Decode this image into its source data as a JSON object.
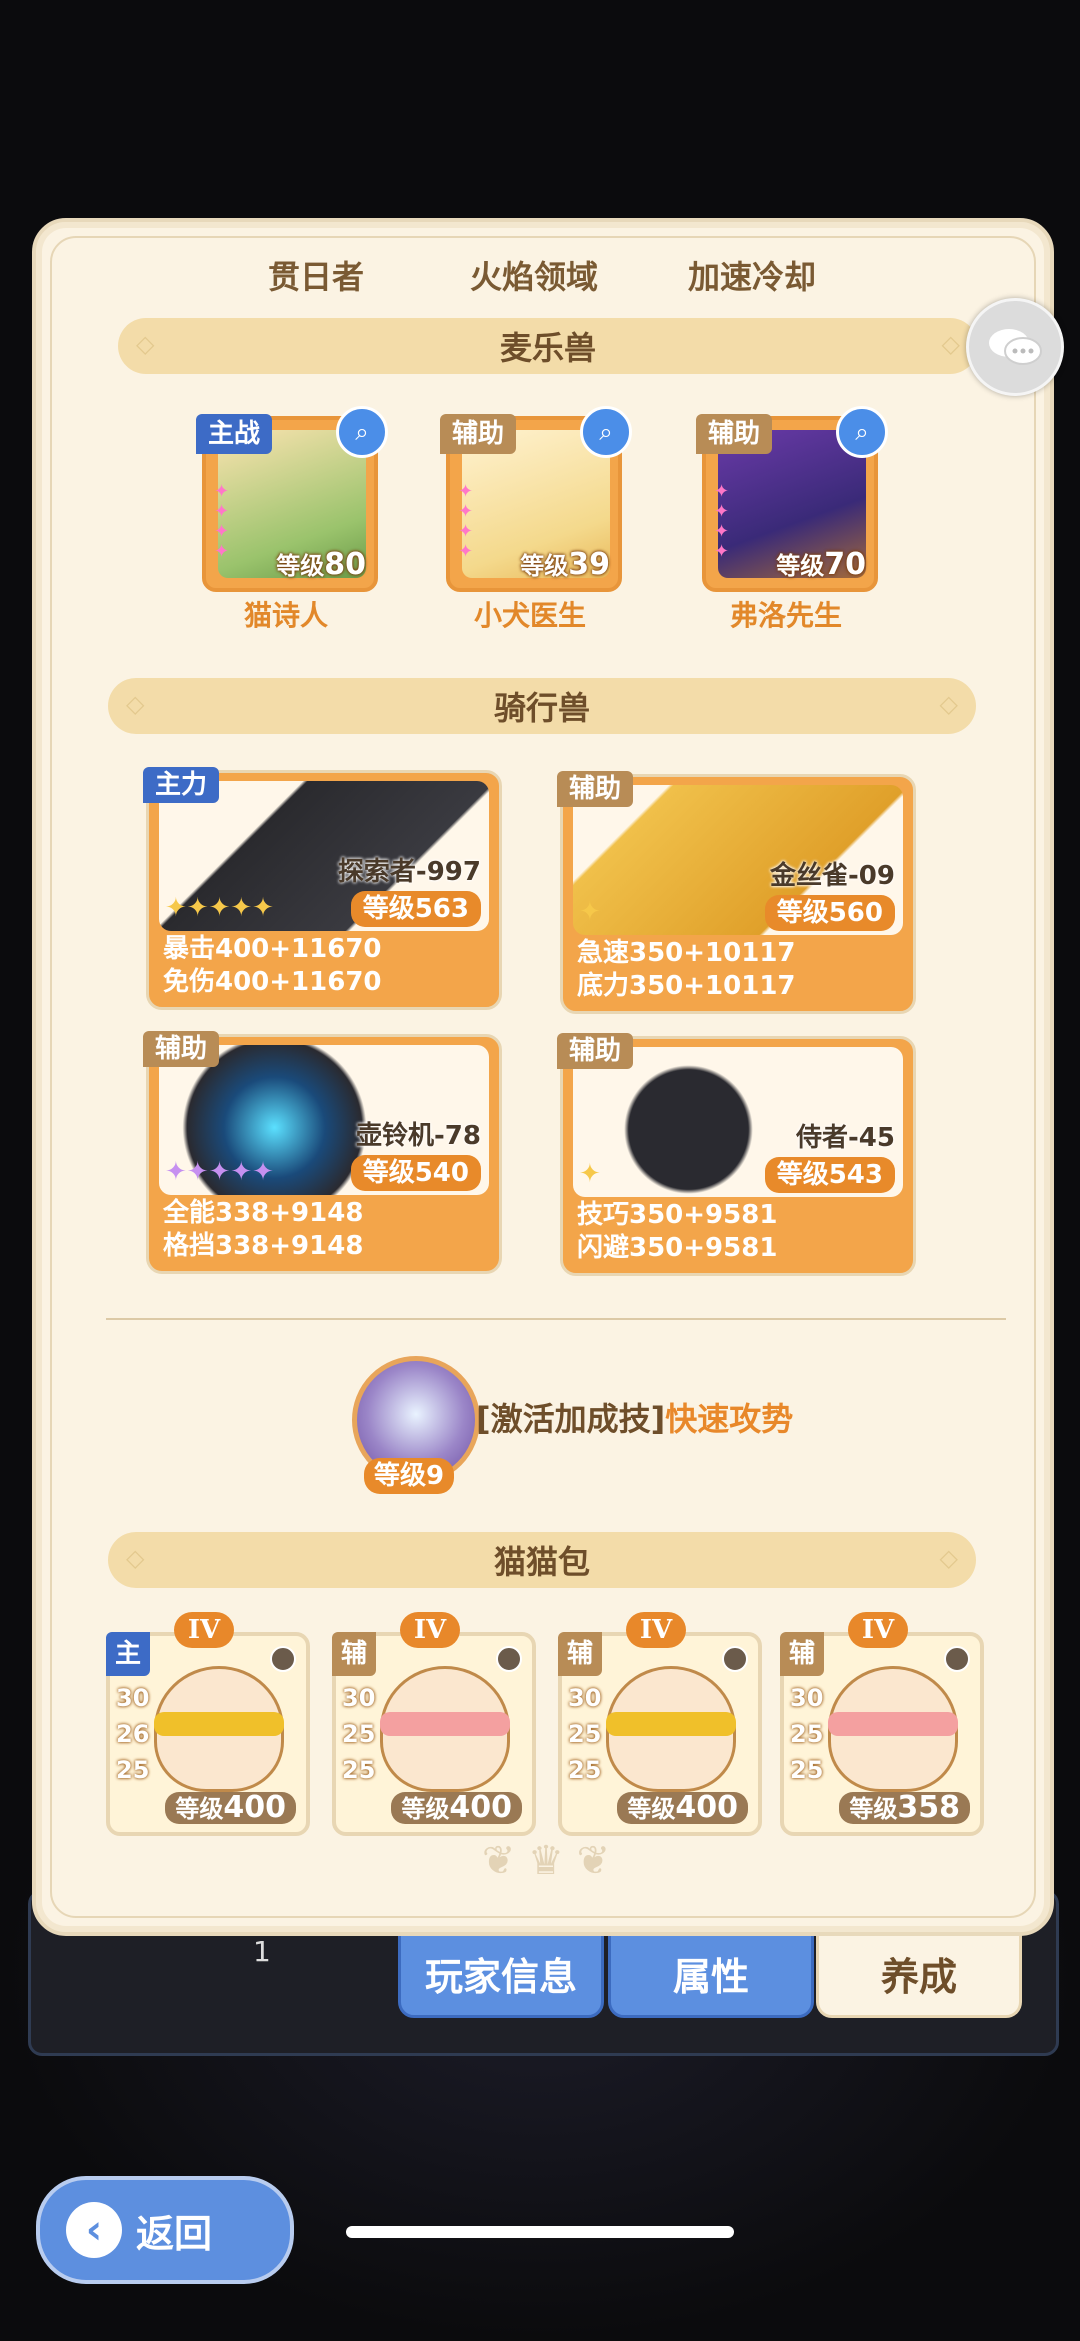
{
  "skill_tabs": [
    "贯日者",
    "火焰领域",
    "加速冷却"
  ],
  "sections": {
    "pets": "麦乐兽",
    "mounts": "骑行兽",
    "bags": "猫猫包"
  },
  "pets": [
    {
      "role": "主战",
      "level_prefix": "等级",
      "level": "80",
      "name": "猫诗人"
    },
    {
      "role": "辅助",
      "level_prefix": "等级",
      "level": "39",
      "name": "小犬医生"
    },
    {
      "role": "辅助",
      "level_prefix": "等级",
      "level": "70",
      "name": "弗洛先生"
    }
  ],
  "mounts": [
    {
      "role": "主力",
      "name": "探索者-997",
      "level": "等级563",
      "stat1": "暴击400+11670",
      "stat2": "免伤400+11670"
    },
    {
      "role": "辅助",
      "name": "金丝雀-09",
      "level": "等级560",
      "stat1": "急速350+10117",
      "stat2": "底力350+10117"
    },
    {
      "role": "辅助",
      "name": "壶铃机-78",
      "level": "等级540",
      "stat1": "全能338+9148",
      "stat2": "格挡338+9148"
    },
    {
      "role": "辅助",
      "name": "侍者-45",
      "level": "等级543",
      "stat1": "技巧350+9581",
      "stat2": "闪避350+9581"
    }
  ],
  "bonus_skill": {
    "level": "等级9",
    "prefix": "[激活加成技]",
    "name": "快速攻势"
  },
  "bags": [
    {
      "grade": "IV",
      "role": "主",
      "nums": [
        "30",
        "26",
        "25"
      ],
      "level_prefix": "等级",
      "level": "400"
    },
    {
      "grade": "IV",
      "role": "辅",
      "nums": [
        "30",
        "25",
        "25"
      ],
      "level_prefix": "等级",
      "level": "400"
    },
    {
      "grade": "IV",
      "role": "辅",
      "nums": [
        "30",
        "25",
        "25"
      ],
      "level_prefix": "等级",
      "level": "400"
    },
    {
      "grade": "IV",
      "role": "辅",
      "nums": [
        "30",
        "25",
        "25"
      ],
      "level_prefix": "等级",
      "level": "358"
    }
  ],
  "bottom_tabs": [
    "玩家信息",
    "属性",
    "养成"
  ],
  "page_number": "1",
  "back_label": "返回",
  "colors": {
    "accent_orange": "#e8882a",
    "main_blue": "#3d6bc6",
    "card_bg": "#fbf3e3"
  }
}
